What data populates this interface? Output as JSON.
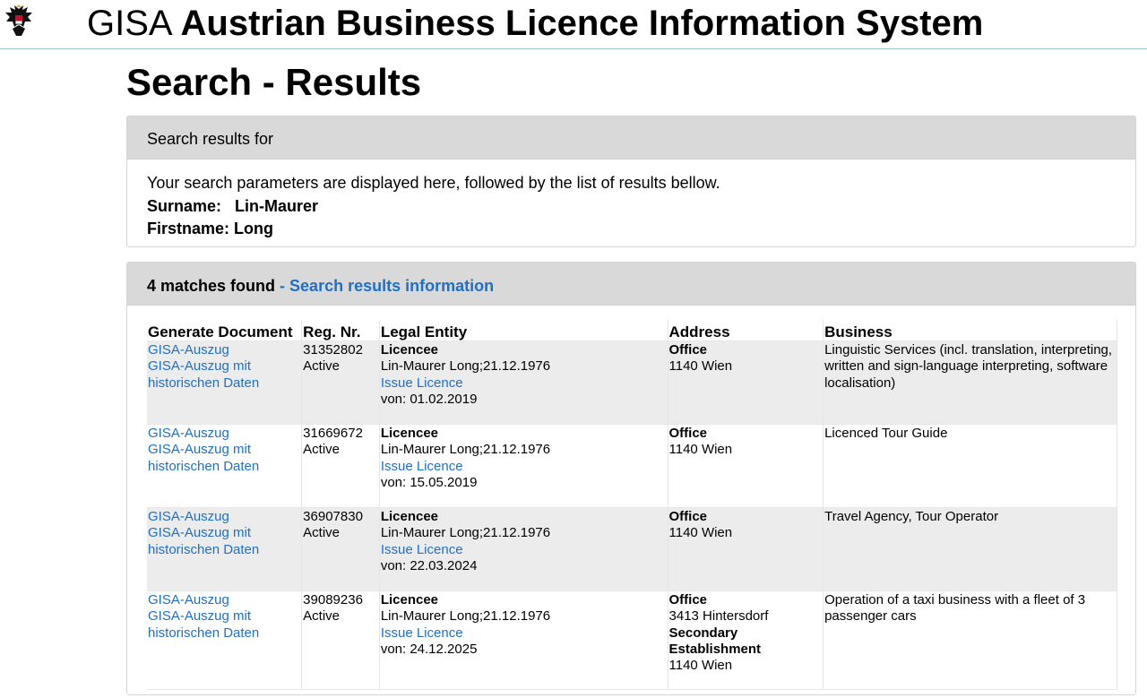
{
  "header": {
    "brand": "GISA",
    "system_title": "Austrian Business Licence Information System",
    "logo_icon": "austrian-eagle-icon"
  },
  "page_title": "Search - Results",
  "search_params": {
    "heading": "Search results for",
    "intro": "Your search parameters are displayed here, followed by the list of results bellow.",
    "surname_label": "Surname:",
    "surname_value": "Lin-Maurer",
    "firstname_label": "Firstname:",
    "firstname_value": "Long"
  },
  "results": {
    "count_text": "4 matches found",
    "info_link": "- Search results information",
    "columns": [
      "Generate Document",
      "Reg. Nr.",
      "Legal Entity",
      "Address",
      "Business"
    ],
    "rows": [
      {
        "doc_links": [
          "GISA-Auszug",
          "GISA-Auszug mit",
          "historischen Daten"
        ],
        "reg_nr": "31352802",
        "status": "Active",
        "role": "Licencee",
        "entity": "Lin-Maurer Long;21.12.1976",
        "issue_link": "Issue Licence",
        "from": "von: 01.02.2019",
        "address_lines": [
          {
            "t": "Office",
            "bold": true
          },
          {
            "t": "1140 Wien",
            "bold": false
          }
        ],
        "business": "Linguistic Services (incl. translation, interpreting, written and sign-language interpreting, software localisation)"
      },
      {
        "doc_links": [
          "GISA-Auszug",
          "GISA-Auszug mit",
          "historischen Daten"
        ],
        "reg_nr": "31669672",
        "status": "Active",
        "role": "Licencee",
        "entity": "Lin-Maurer Long;21.12.1976",
        "issue_link": "Issue Licence",
        "from": "von: 15.05.2019",
        "address_lines": [
          {
            "t": "Office",
            "bold": true
          },
          {
            "t": "1140 Wien",
            "bold": false
          }
        ],
        "business": "Licenced Tour Guide"
      },
      {
        "doc_links": [
          "GISA-Auszug",
          "GISA-Auszug mit",
          "historischen Daten"
        ],
        "reg_nr": "36907830",
        "status": "Active",
        "role": "Licencee",
        "entity": "Lin-Maurer Long;21.12.1976",
        "issue_link": "Issue Licence",
        "from": "von: 22.03.2024",
        "address_lines": [
          {
            "t": "Office",
            "bold": true
          },
          {
            "t": "1140 Wien",
            "bold": false
          }
        ],
        "business": "Travel Agency, Tour Operator"
      },
      {
        "doc_links": [
          "GISA-Auszug",
          "GISA-Auszug mit",
          "historischen Daten"
        ],
        "reg_nr": "39089236",
        "status": "Active",
        "role": "Licencee",
        "entity": "Lin-Maurer Long;21.12.1976",
        "issue_link": "Issue Licence",
        "from": "von: 24.12.2025",
        "address_lines": [
          {
            "t": "Office",
            "bold": true
          },
          {
            "t": "3413 Hintersdorf",
            "bold": false
          },
          {
            "t": "Secondary Establishment",
            "bold": true
          },
          {
            "t": "1140 Wien",
            "bold": false
          }
        ],
        "business": "Operation of a taxi business with a fleet of 3 passenger cars"
      }
    ]
  },
  "colors": {
    "link": "#1f6fc8",
    "panel_header": "#d9d9d9",
    "row_shade": "#ececec",
    "topbar_border": "#9cc3cf"
  }
}
